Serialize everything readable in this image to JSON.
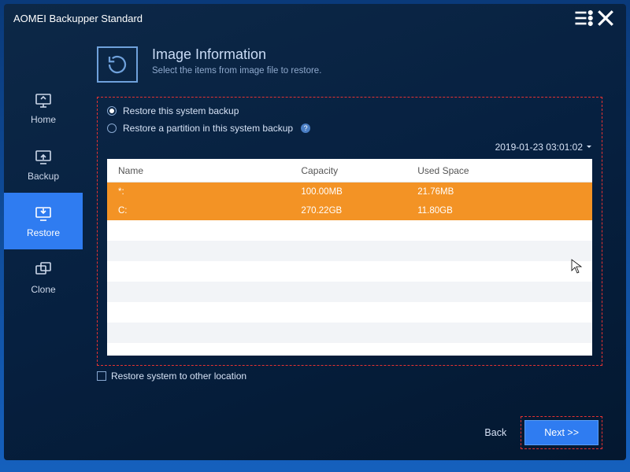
{
  "app": {
    "title": "AOMEI Backupper Standard"
  },
  "sidebar": {
    "items": [
      {
        "label": "Home"
      },
      {
        "label": "Backup"
      },
      {
        "label": "Restore"
      },
      {
        "label": "Clone"
      }
    ]
  },
  "header": {
    "title": "Image Information",
    "subtitle": "Select the items from image file to restore."
  },
  "options": {
    "opt1": "Restore this system backup",
    "opt2": "Restore a partition in this system backup"
  },
  "timestamp": "2019-01-23 03:01:02",
  "table": {
    "headers": {
      "name": "Name",
      "capacity": "Capacity",
      "used": "Used Space"
    },
    "rows": [
      {
        "name": "*:",
        "capacity": "100.00MB",
        "used": "21.76MB"
      },
      {
        "name": "C:",
        "capacity": "270.22GB",
        "used": "11.80GB"
      }
    ]
  },
  "checkbox": {
    "label": "Restore system to other location"
  },
  "footer": {
    "back": "Back",
    "next": "Next >>"
  }
}
